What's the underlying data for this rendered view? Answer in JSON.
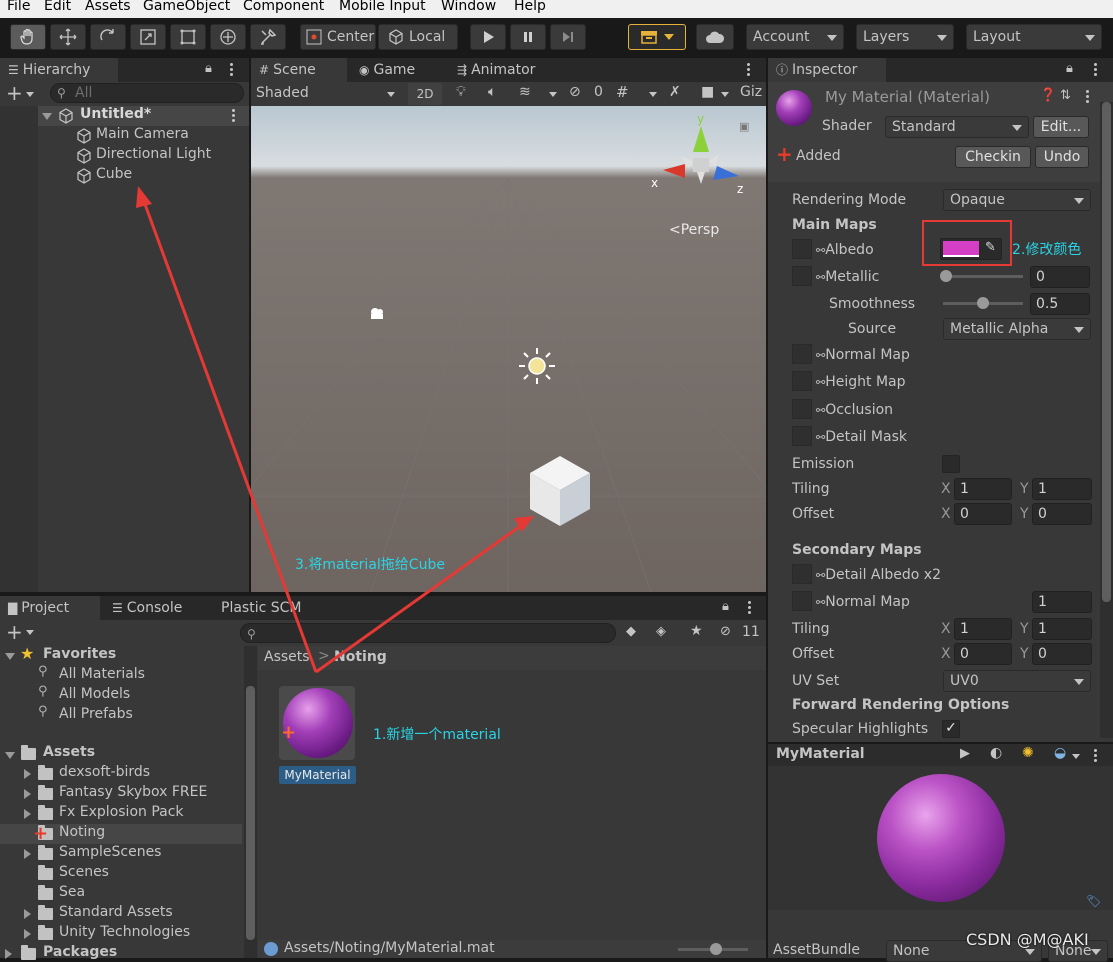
{
  "menu": [
    "File",
    "Edit",
    "Assets",
    "GameObject",
    "Component",
    "Mobile Input",
    "Window",
    "Help"
  ],
  "toolbar": {
    "pivot_label": "Center",
    "space_label": "Local",
    "account_label": "Account",
    "layers_label": "Layers",
    "layout_label": "Layout",
    "accent": "#e5b23a"
  },
  "hierarchy": {
    "tab": "Hierarchy",
    "search_placeholder": "All",
    "scene_name": "Untitled*",
    "items": [
      "Main Camera",
      "Directional Light",
      "Cube"
    ]
  },
  "scene": {
    "tabs": [
      "Scene",
      "Game",
      "Animator"
    ],
    "shading": "Shaded",
    "mode_2d": "2D",
    "hidden_count": "0",
    "gizmos": "Giz",
    "persp": "<Persp",
    "gizmo_axes": {
      "x": "x",
      "y": "y",
      "z": "z"
    },
    "annotation_drag": "3.将material拖给Cube"
  },
  "project": {
    "tabs": [
      "Project",
      "Console",
      "Plastic SCM"
    ],
    "hidden_count": "11",
    "favorites_title": "Favorites",
    "favorites": [
      "All Materials",
      "All Models",
      "All Prefabs"
    ],
    "assets_title": "Assets",
    "folders": [
      "dexsoft-birds",
      "Fantasy Skybox FREE",
      "Fx Explosion Pack",
      "Noting",
      "SampleScenes",
      "Scenes",
      "Sea",
      "Standard Assets",
      "Unity Technologies"
    ],
    "packages_title": "Packages",
    "breadcrumb_root": "Assets",
    "breadcrumb_current": "Noting",
    "asset_name": "MyMaterial",
    "annotation_new": "1.新增一个material",
    "status_path": "Assets/Noting/MyMaterial.mat"
  },
  "inspector": {
    "tab": "Inspector",
    "title": "My Material (Material)",
    "shader_label": "Shader",
    "shader_value": "Standard",
    "edit_button": "Edit...",
    "added_label": "Added",
    "checkin_button": "Checkin",
    "undo_button": "Undo",
    "rendering_mode_label": "Rendering Mode",
    "rendering_mode_value": "Opaque",
    "main_maps": "Main Maps",
    "albedo": "Albedo",
    "albedo_color": "#d43fc6",
    "annotation_color": "2.修改颜色",
    "metallic": "Metallic",
    "metallic_value": "0",
    "smoothness": "Smoothness",
    "smoothness_value": "0.5",
    "smoothness_fraction": 0.5,
    "source": "Source",
    "source_value": "Metallic Alpha",
    "normal_map": "Normal Map",
    "height_map": "Height Map",
    "occlusion": "Occlusion",
    "detail_mask": "Detail Mask",
    "emission": "Emission",
    "tiling": "Tiling",
    "offset": "Offset",
    "x_label": "X",
    "y_label": "Y",
    "tiling_x": "1",
    "tiling_y": "1",
    "offset_x": "0",
    "offset_y": "0",
    "secondary_maps": "Secondary Maps",
    "detail_albedo": "Detail Albedo x2",
    "normal_map2": "Normal Map",
    "normal_map2_value": "1",
    "tiling2_x": "1",
    "tiling2_y": "1",
    "offset2_x": "0",
    "offset2_y": "0",
    "uv_set": "UV Set",
    "uv_set_value": "UV0",
    "forward_options": "Forward Rendering Options",
    "specular_highlights": "Specular Highlights",
    "preview_title": "MyMaterial",
    "assetbundle_label": "AssetBundle",
    "assetbundle_value": "None",
    "assetbundle_variant": "None",
    "watermark": "CSDN @M@AKI"
  }
}
